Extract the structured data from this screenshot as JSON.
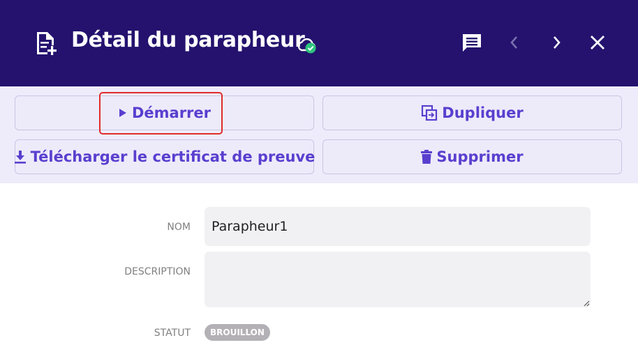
{
  "header": {
    "title": "Détail du parapheur",
    "icons": [
      "doc-add-icon",
      "cloud-check-icon",
      "comment-icon",
      "chevron-left-icon",
      "chevron-right-icon",
      "close-icon"
    ],
    "colors": {
      "background": "#24126e",
      "sync_ok": "#2ec27e",
      "disabled_nav": "#7a6fb0"
    }
  },
  "actions": {
    "start_label": "Démarrer",
    "duplicate_label": "Dupliquer",
    "download_certificate_label": "Télécharger le certificat de preuve",
    "delete_label": "Supprimer",
    "accent_color": "#5a3fcf"
  },
  "form": {
    "name_label": "Nom",
    "name_value": "Parapheur1",
    "description_label": "Description",
    "description_value": "",
    "status_label": "Statut",
    "status_value": "Brouillon"
  }
}
